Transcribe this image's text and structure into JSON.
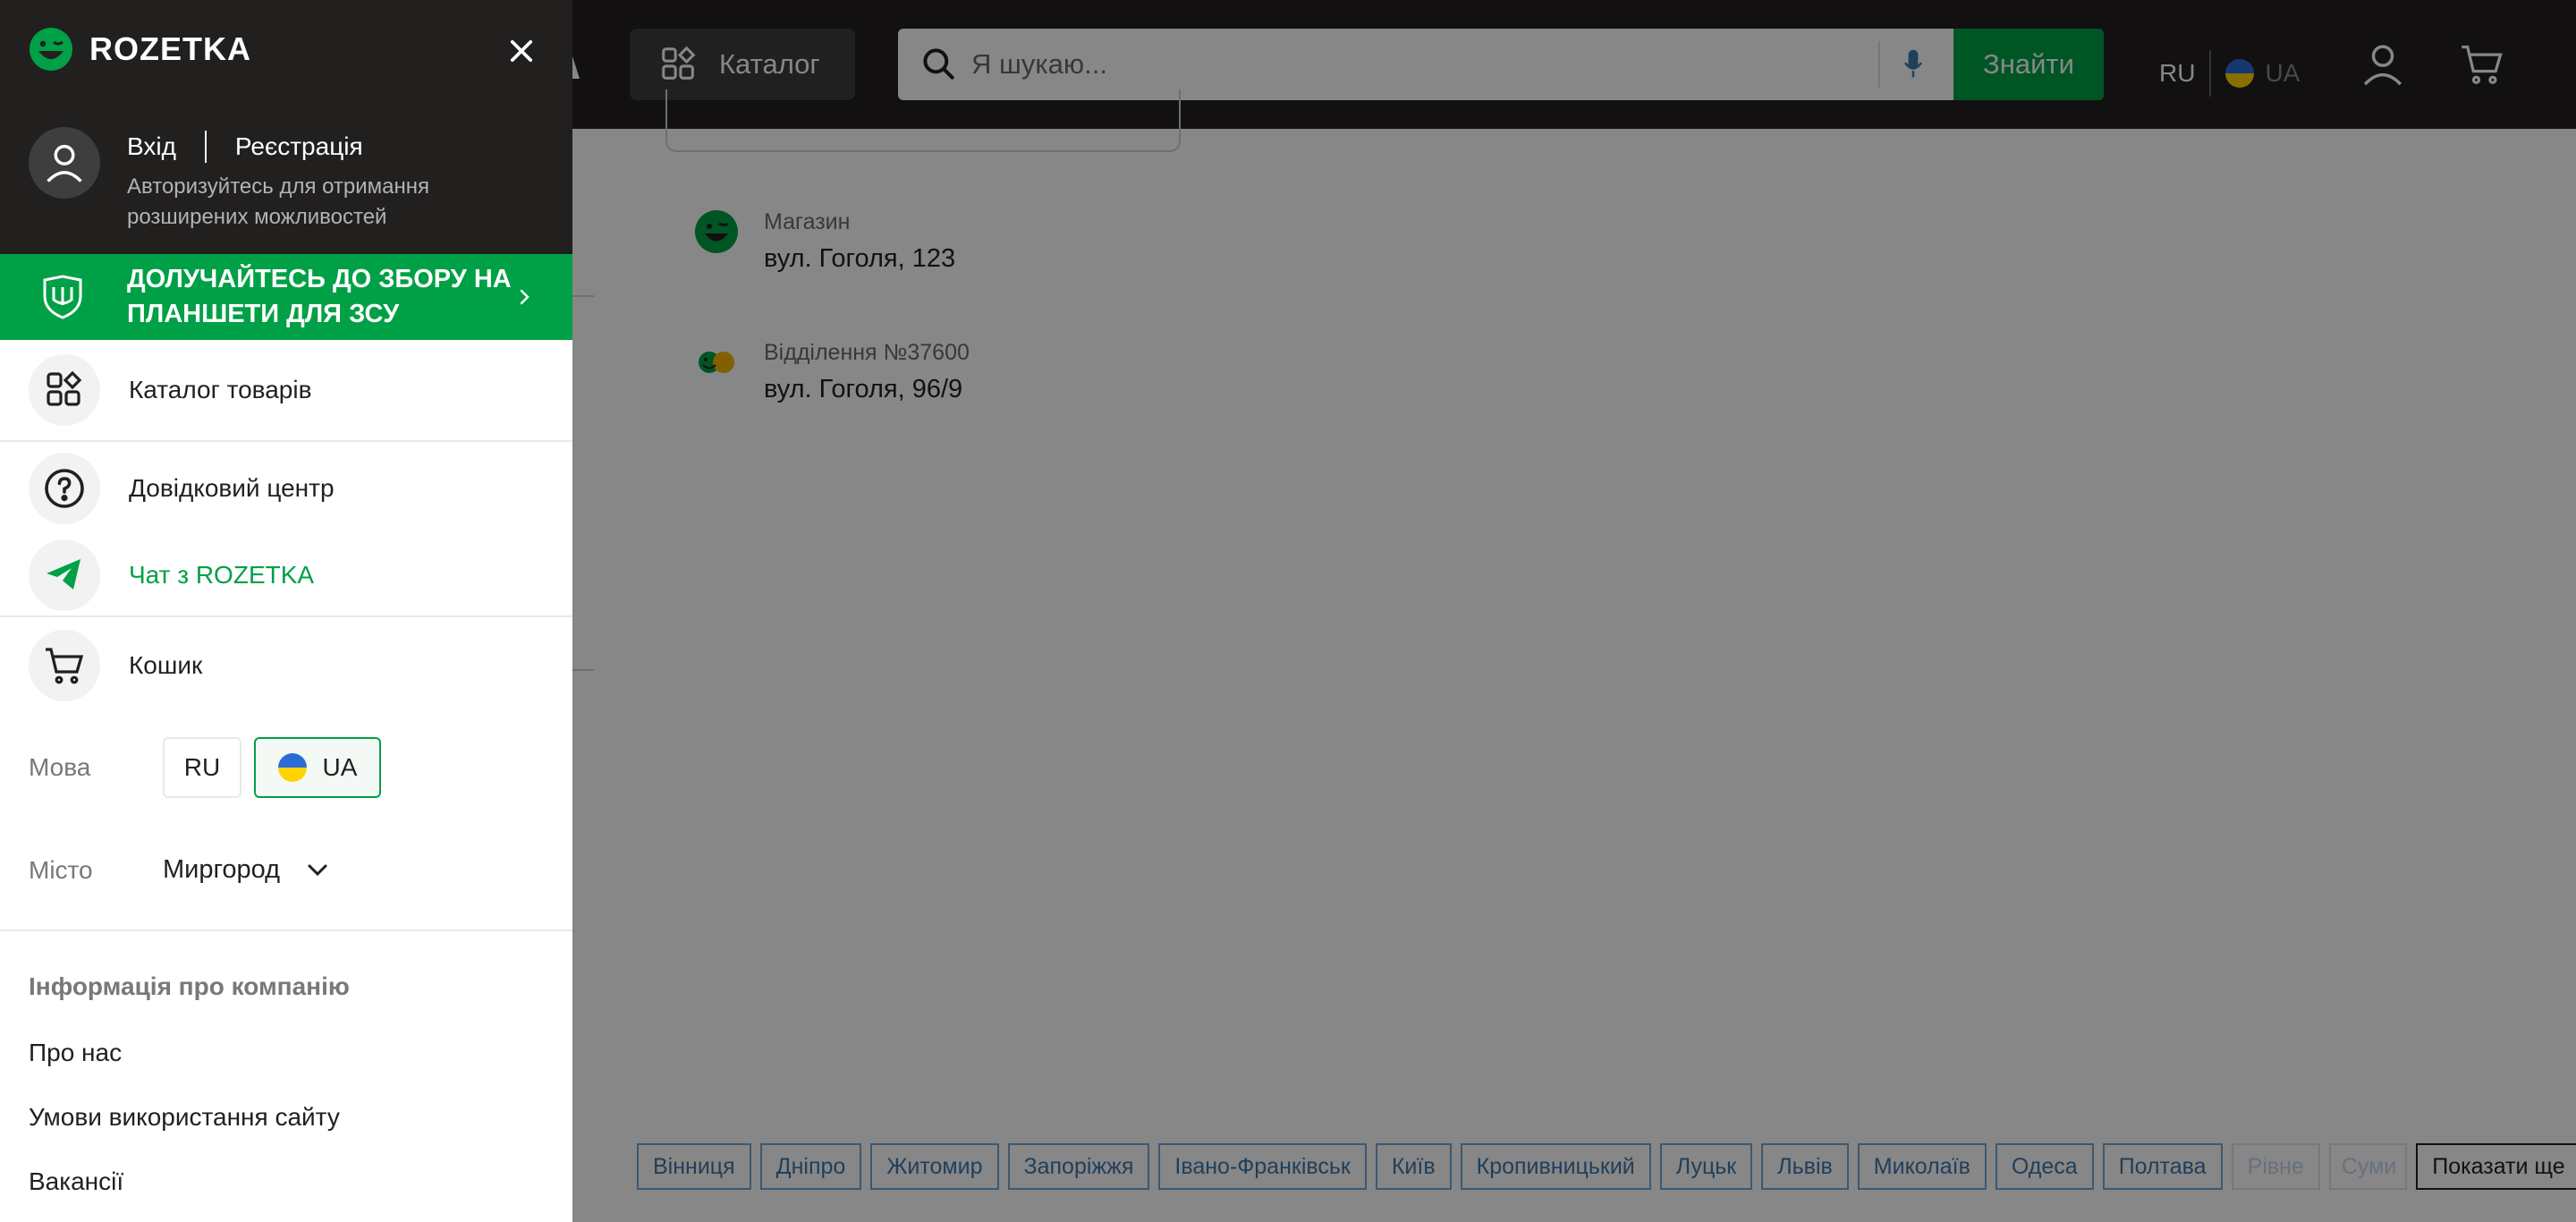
{
  "header": {
    "catalog_label": "Каталог",
    "search_placeholder": "Я шукаю...",
    "search_button": "Знайти",
    "lang_ru": "RU",
    "lang_ua": "UA"
  },
  "locations": [
    {
      "type": "Магазин",
      "address": "вул. Гоголя, 123"
    },
    {
      "type": "Відділення №37600",
      "address": "вул. Гоголя, 96/9"
    }
  ],
  "cities": [
    "Вінниця",
    "Дніпро",
    "Житомир",
    "Запоріжжя",
    "Івано-Франківськ",
    "Київ",
    "Кропивницький",
    "Луцьк",
    "Львів",
    "Миколаїв",
    "Одеса",
    "Полтава",
    "Рівне",
    "Суми"
  ],
  "show_more": "Показати ще",
  "drawer": {
    "brand": "ROZETKA",
    "login": "Вхід",
    "register": "Реєстрація",
    "auth_hint": "Авторизуйтесь для отримання розширених можливостей",
    "promo": "ДОЛУЧАЙТЕСЬ ДО ЗБОРУ НА ПЛАНШЕТИ ДЛЯ ЗСУ",
    "menu": {
      "catalog": "Каталог товарів",
      "help": "Довідковий центр",
      "chat": "Чат з ROZETKA",
      "cart": "Кошик"
    },
    "language_label": "Мова",
    "lang_ru": "RU",
    "lang_ua": "UA",
    "city_label": "Місто",
    "city_value": "Миргород",
    "info_title": "Інформація про компанію",
    "info_links": [
      "Про нас",
      "Умови використання сайту",
      "Вакансії"
    ]
  },
  "colors": {
    "brand_green": "#00a046",
    "header_dark": "#221f1f",
    "city_link": "#3e77aa"
  }
}
